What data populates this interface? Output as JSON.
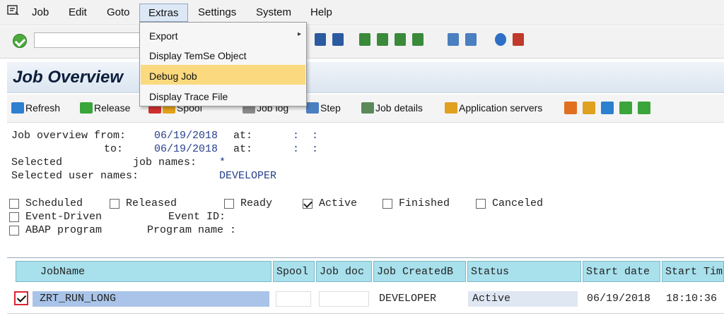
{
  "menubar": {
    "items": [
      "Job",
      "Edit",
      "Goto",
      "Extras",
      "Settings",
      "System",
      "Help"
    ]
  },
  "extras_menu": {
    "items": [
      {
        "label": "Export",
        "submenu": true
      },
      {
        "label": "Display TemSe Object",
        "submenu": false
      },
      {
        "label": "Debug Job",
        "submenu": false,
        "highlighted": true
      },
      {
        "label": "Display Trace File",
        "submenu": false
      }
    ]
  },
  "title": "Job Overview",
  "app_toolbar": {
    "refresh": "Refresh",
    "release": "Release",
    "spool": "Spool",
    "job_log": "Job log",
    "step": "Step",
    "job_details": "Job details",
    "application_servers": "Application servers"
  },
  "selection": {
    "overview_from_label": "Job overview from:",
    "from_date": "06/19/2018",
    "at_label": "at:",
    "from_time": ":  :",
    "to_label": "to:",
    "to_date": "06/19/2018",
    "to_time": ":  :",
    "selected_label": "Selected",
    "job_names_label": "job names:",
    "job_names_value": "*",
    "user_names_label": "Selected user names:",
    "user_names_value": "DEVELOPER"
  },
  "status_filters": [
    {
      "label": "Scheduled",
      "checked": false
    },
    {
      "label": "Released",
      "checked": false
    },
    {
      "label": "Ready",
      "checked": false
    },
    {
      "label": "Active",
      "checked": true
    },
    {
      "label": "Finished",
      "checked": false
    },
    {
      "label": "Canceled",
      "checked": false
    }
  ],
  "event_driven": {
    "label": "Event-Driven",
    "event_id_label": "Event ID:"
  },
  "abap_program": {
    "label": "ABAP program",
    "program_name_label": "Program name :"
  },
  "table": {
    "columns": [
      "JobName",
      "Spool",
      "Job doc",
      "Job CreatedB",
      "Status",
      "Start date",
      "Start Time"
    ],
    "rows": [
      {
        "selected": true,
        "job_name": "ZRT_RUN_LONG",
        "spool": "",
        "job_doc": "",
        "created_by": "DEVELOPER",
        "status": "Active",
        "start_date": "06/19/2018",
        "start_time": "18:10:36"
      }
    ]
  },
  "colors": {
    "menu_highlight": "#fbd97e",
    "table_header": "#a8e0ec",
    "value_text": "#27408b",
    "ok_green": "#4caa3c"
  }
}
